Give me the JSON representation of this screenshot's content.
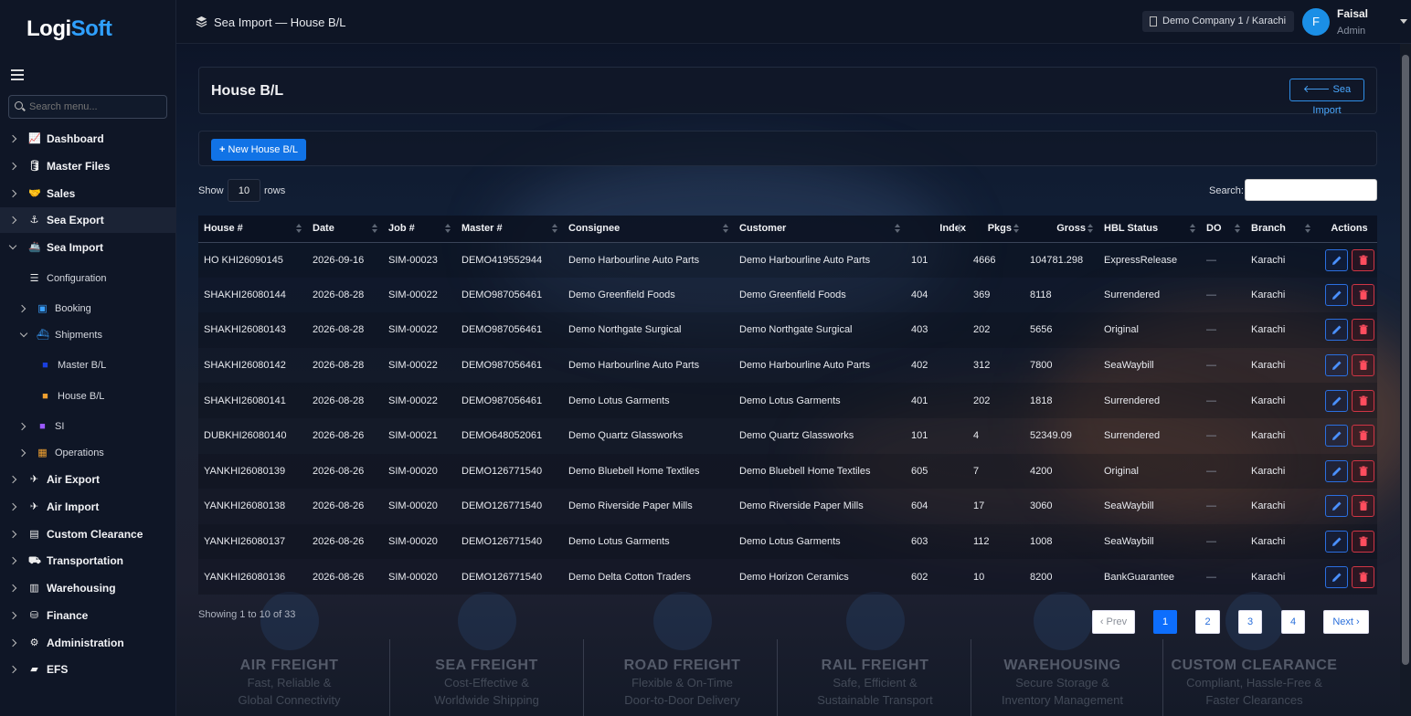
{
  "brand": {
    "name_a": "Logi",
    "name_b": "Soft"
  },
  "sidebar": {
    "search_placeholder": "Search menu...",
    "items": [
      {
        "label": "Dashboard",
        "icon": "chart-line-icon"
      },
      {
        "label": "Master Files",
        "icon": "database-icon"
      },
      {
        "label": "Sales",
        "icon": "handshake-icon"
      },
      {
        "label": "Sea Export",
        "icon": "anchor-icon"
      },
      {
        "label": "Sea Import",
        "icon": "ship-icon"
      },
      {
        "label": "Configuration",
        "icon": "sliders-icon"
      },
      {
        "label": "Booking",
        "icon": "clipboard-icon"
      },
      {
        "label": "Shipments",
        "icon": "ship-icon"
      },
      {
        "label": "Master B/L",
        "icon": "file-icon"
      },
      {
        "label": "House B/L",
        "icon": "file-icon"
      },
      {
        "label": "SI",
        "icon": "file-icon"
      },
      {
        "label": "Operations",
        "icon": "boxes-icon"
      },
      {
        "label": "Air Export",
        "icon": "plane-icon"
      },
      {
        "label": "Air Import",
        "icon": "plane-arrival-icon"
      },
      {
        "label": "Custom Clearance",
        "icon": "file-shield-icon"
      },
      {
        "label": "Transportation",
        "icon": "truck-icon"
      },
      {
        "label": "Warehousing",
        "icon": "warehouse-icon"
      },
      {
        "label": "Finance",
        "icon": "coins-icon"
      },
      {
        "label": "Administration",
        "icon": "gear-icon"
      },
      {
        "label": "EFS",
        "icon": "folder-icon"
      }
    ]
  },
  "topbar": {
    "title": "Sea Import — House B/L",
    "company": "Demo Company 1 / Karachi",
    "user_initial": "F",
    "user_name": "Faisal",
    "user_role": "Admin"
  },
  "page": {
    "title": "House B/L",
    "back_label": "Sea Import",
    "new_label": "New House B/L",
    "show_label": "Show",
    "rows_value": "10",
    "rows_label": "rows",
    "search_label": "Search:",
    "showing": "Showing 1 to 10 of 33"
  },
  "table": {
    "headers": [
      "House #",
      "Date",
      "Job #",
      "Master #",
      "Consignee",
      "Customer",
      "Index",
      "Pkgs",
      "Gross",
      "HBL Status",
      "DO",
      "Branch",
      "Actions"
    ],
    "rows": [
      [
        "HO KHI26090145",
        "2026-09-16",
        "SIM-00023",
        "DEMO419552944",
        "Demo Harbourline Auto Parts",
        "Demo Harbourline Auto Parts",
        "101",
        "4666",
        "104781.298",
        "ExpressRelease",
        "—",
        "Karachi"
      ],
      [
        "SHAKHI26080144",
        "2026-08-28",
        "SIM-00022",
        "DEMO987056461",
        "Demo Greenfield Foods",
        "Demo Greenfield Foods",
        "404",
        "369",
        "8118",
        "Surrendered",
        "—",
        "Karachi"
      ],
      [
        "SHAKHI26080143",
        "2026-08-28",
        "SIM-00022",
        "DEMO987056461",
        "Demo Northgate Surgical",
        "Demo Northgate Surgical",
        "403",
        "202",
        "5656",
        "Original",
        "—",
        "Karachi"
      ],
      [
        "SHAKHI26080142",
        "2026-08-28",
        "SIM-00022",
        "DEMO987056461",
        "Demo Harbourline Auto Parts",
        "Demo Harbourline Auto Parts",
        "402",
        "312",
        "7800",
        "SeaWaybill",
        "—",
        "Karachi"
      ],
      [
        "SHAKHI26080141",
        "2026-08-28",
        "SIM-00022",
        "DEMO987056461",
        "Demo Lotus Garments",
        "Demo Lotus Garments",
        "401",
        "202",
        "1818",
        "Surrendered",
        "—",
        "Karachi"
      ],
      [
        "DUBKHI26080140",
        "2026-08-26",
        "SIM-00021",
        "DEMO648052061",
        "Demo Quartz Glassworks",
        "Demo Quartz Glassworks",
        "101",
        "4",
        "52349.09",
        "Surrendered",
        "—",
        "Karachi"
      ],
      [
        "YANKHI26080139",
        "2026-08-26",
        "SIM-00020",
        "DEMO126771540",
        "Demo Bluebell Home Textiles",
        "Demo Bluebell Home Textiles",
        "605",
        "7",
        "4200",
        "Original",
        "—",
        "Karachi"
      ],
      [
        "YANKHI26080138",
        "2026-08-26",
        "SIM-00020",
        "DEMO126771540",
        "Demo Riverside Paper Mills",
        "Demo Riverside Paper Mills",
        "604",
        "17",
        "3060",
        "SeaWaybill",
        "—",
        "Karachi"
      ],
      [
        "YANKHI26080137",
        "2026-08-26",
        "SIM-00020",
        "DEMO126771540",
        "Demo Lotus Garments",
        "Demo Lotus Garments",
        "603",
        "112",
        "1008",
        "SeaWaybill",
        "—",
        "Karachi"
      ],
      [
        "YANKHI26080136",
        "2026-08-26",
        "SIM-00020",
        "DEMO126771540",
        "Demo Delta Cotton Traders",
        "Demo Horizon Ceramics",
        "602",
        "10",
        "8200",
        "BankGuarantee",
        "—",
        "Karachi"
      ]
    ]
  },
  "pagination": {
    "prev": "‹ Prev",
    "pages": [
      "1",
      "2",
      "3",
      "4"
    ],
    "current": "1",
    "next": "Next ›"
  },
  "services": [
    {
      "title": "AIR FREIGHT",
      "l1": "Fast, Reliable &",
      "l2": "Global Connectivity"
    },
    {
      "title": "SEA FREIGHT",
      "l1": "Cost-Effective &",
      "l2": "Worldwide Shipping"
    },
    {
      "title": "ROAD FREIGHT",
      "l1": "Flexible & On-Time",
      "l2": "Door-to-Door Delivery"
    },
    {
      "title": "RAIL FREIGHT",
      "l1": "Safe, Efficient &",
      "l2": "Sustainable Transport"
    },
    {
      "title": "WAREHOUSING",
      "l1": "Secure Storage &",
      "l2": "Inventory Management"
    },
    {
      "title": "CUSTOM CLEARANCE",
      "l1": "Compliant, Hassle-Free &",
      "l2": "Faster Clearances"
    }
  ],
  "colors": {
    "accent": "#1173e6",
    "edit": "#2b6fe0",
    "delete": "#d03545",
    "brand_blue": "#2fa0ff"
  }
}
